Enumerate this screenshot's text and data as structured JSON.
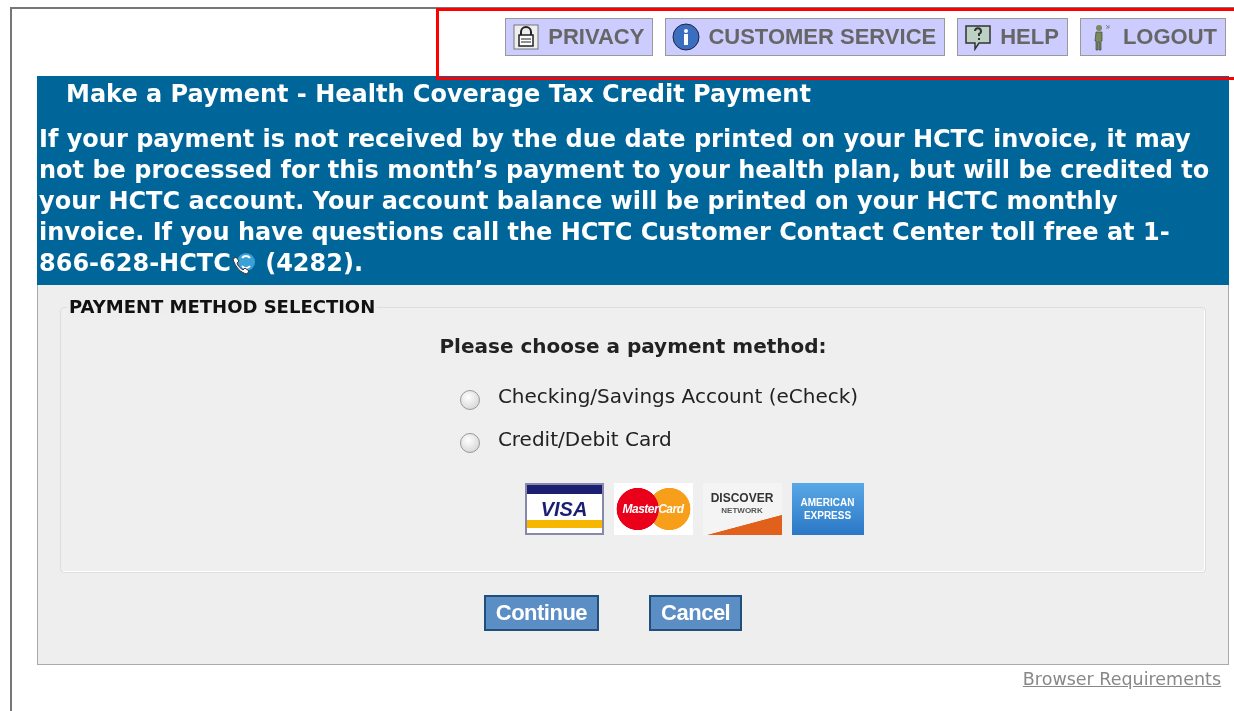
{
  "nav": [
    {
      "label": "PRIVACY",
      "kind": "lock"
    },
    {
      "label": "CUSTOMER SERVICE",
      "kind": "info"
    },
    {
      "label": "HELP",
      "kind": "help"
    },
    {
      "label": "LOGOUT",
      "kind": "person"
    }
  ],
  "banner": {
    "title": "Make a Payment - Health Coverage Tax Credit Payment",
    "message_before_icon": "If your payment is not received by the due date printed on your HCTC invoice, it may not be processed for this month’s payment to your health plan, but will be credited to your HCTC account. Your account balance will be printed on your HCTC monthly invoice. If you have questions call the HCTC Customer Contact Center toll free at 1-866-628-HCTC",
    "message_after_icon": " (4282)."
  },
  "payment_method": {
    "legend": "PAYMENT METHOD SELECTION",
    "prompt": "Please choose a payment method:",
    "options": [
      {
        "label": "Checking/Savings Account (eCheck)",
        "selected": false
      },
      {
        "label": "Credit/Debit Card",
        "selected": false
      }
    ],
    "cards": [
      {
        "kind": "visa",
        "texts": [
          "VISA"
        ]
      },
      {
        "kind": "mastercard",
        "texts": [
          "MasterCard"
        ]
      },
      {
        "kind": "discover",
        "texts": [
          "DISCOVER",
          "NETWORK"
        ]
      },
      {
        "kind": "amex",
        "texts": [
          "AMERICAN",
          "EXPRESS"
        ]
      }
    ]
  },
  "buttons": [
    "Continue",
    "Cancel"
  ],
  "footer_link": "Browser Requirements"
}
